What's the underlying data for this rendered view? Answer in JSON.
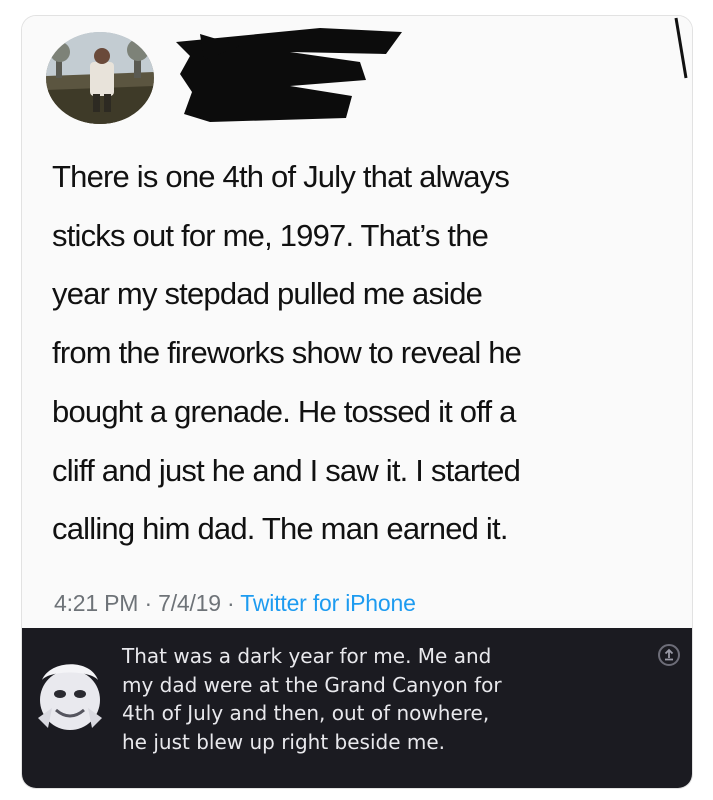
{
  "tweet": {
    "avatar_icon": "profile-photo",
    "author_redacted": true,
    "text": "There is one 4th of July that always\nsticks out for me, 1997. That’s the\nyear my stepdad pulled me aside\nfrom the fireworks show to reveal he\nbought a grenade. He tossed it off a\ncliff and just he and I saw it. I started\ncalling him dad. The man earned it.",
    "time": "4:21 PM",
    "separator": " · ",
    "date": "7/4/19",
    "source": "Twitter for iPhone"
  },
  "reply": {
    "avatar_icon": "cartoon-avatar-icon",
    "text": "That was a dark year for me. Me and\nmy dad were at the Grand Canyon for\n4th of July and then, out of nowhere,\nhe just blew up right beside me.",
    "share_icon": "share-icon"
  },
  "colors": {
    "tweet_bg": "#fafafa",
    "reply_bg": "#1b1b21",
    "source_link": "#1d9bf0",
    "meta_text": "#6e7378"
  }
}
